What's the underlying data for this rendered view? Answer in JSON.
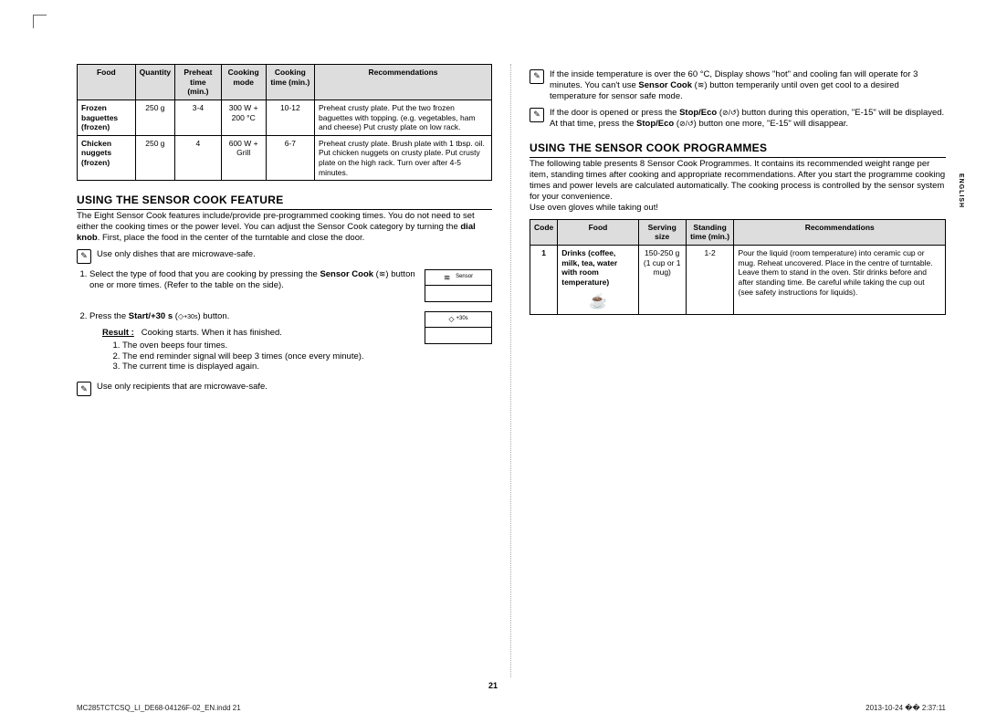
{
  "leftTable": {
    "headers": [
      "Food",
      "Quantity",
      "Preheat time (min.)",
      "Cooking mode",
      "Cooking time (min.)",
      "Recommendations"
    ],
    "rows": [
      {
        "food": "Frozen baguettes (frozen)",
        "qty": "250 g",
        "preheat": "3-4",
        "mode": "300 W + 200 °C",
        "time": "10-12",
        "rec": "Preheat crusty plate. Put the two frozen baguettes with topping. (e.g. vegetables, ham and cheese) Put crusty plate on low rack."
      },
      {
        "food": "Chicken nuggets (frozen)",
        "qty": "250 g",
        "preheat": "4",
        "mode": "600 W + Grill",
        "time": "6-7",
        "rec": "Preheat crusty plate. Brush plate with 1 tbsp. oil. Put chicken nuggets on crusty plate. Put crusty plate on the high rack. Turn over after 4-5 minutes."
      }
    ]
  },
  "feature": {
    "heading": "USING THE SENSOR COOK FEATURE",
    "intro": "The Eight Sensor Cook features include/provide pre-programmed cooking times. You do not need to set either the cooking times or the power level. You can adjust the Sensor Cook category by turning the ",
    "introBold": "dial knob",
    "introEnd": ". First, place the food in the center of the turntable and close the door.",
    "note1": "Use only dishes that are microwave-safe.",
    "step1a": "Select the type of food that you are cooking by pressing the ",
    "step1b": "Sensor Cook",
    "step1c": " button one or more times. (Refer to the table on the side).",
    "fig1": "Sensor",
    "step2a": "Press the ",
    "step2b": "Start/+30 s",
    "step2c": " button.",
    "fig2": "+30s",
    "resultLbl": "Result :",
    "resultLine": "Cooking starts. When it has finished.",
    "r1": "The oven beeps four times.",
    "r2": "The end reminder signal will beep 3 times (once every minute).",
    "r3": "The current time is displayed again.",
    "note2": "Use only recipients that are microwave-safe."
  },
  "rightNotes": {
    "n1": "If the inside temperature is over the 60 °C, Display shows \"hot\" and cooling fan will operate for 3 minutes. You can't use ",
    "n1b": "Sensor Cook",
    "n1c": " button temperarily until oven get cool to a desired temperature for sensor safe mode.",
    "n2": "If the door is opened or press the ",
    "n2b": "Stop/Eco",
    "n2c": " button during this operation, \"E-15\" will be displayed. At that time, press the ",
    "n2d": "Stop/Eco",
    "n2e": " button one more, \"E-15\" will disappear."
  },
  "programmes": {
    "heading": "USING THE SENSOR COOK PROGRAMMES",
    "intro": "The following table presents 8 Sensor Cook Programmes. It contains its recommended weight range per item, standing times after cooking and appropriate recommendations. After you start the programme cooking times and power levels are calculated automatically. The cooking process is controlled by the sensor system for your convenience.",
    "intro2": "Use oven gloves while taking out!",
    "headers": [
      "Code",
      "Food",
      "Serving size",
      "Standing time (min.)",
      "Recommendations"
    ],
    "row": {
      "code": "1",
      "food": "Drinks (coffee, milk, tea, water with room temperature)",
      "size": "150-250 g (1 cup or 1 mug)",
      "stand": "1-2",
      "rec": "Pour the liquid (room temperature) into ceramic cup or mug. Reheat uncovered. Place in the centre of turntable. Leave them to stand in the oven. Stir drinks before and after standing time. Be careful while taking the cup out (see safety instructions for liquids)."
    }
  },
  "page": "21",
  "footL": "MC285TCTCSQ_LI_DE68-04126F-02_EN.indd   21",
  "footR": "2013-10-24   �� 2:37:11",
  "language": "ENGLISH"
}
